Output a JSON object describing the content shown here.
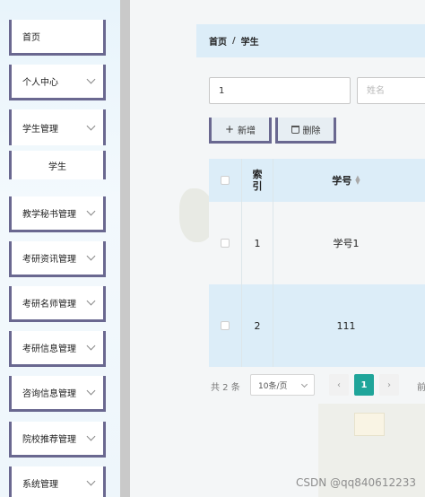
{
  "sidebar": {
    "items": [
      {
        "label": "首页",
        "has_chevron": false
      },
      {
        "label": "个人中心",
        "has_chevron": true
      },
      {
        "label": "学生管理",
        "has_chevron": true
      },
      {
        "label": "教学秘书管理",
        "has_chevron": true
      },
      {
        "label": "考研资讯管理",
        "has_chevron": true
      },
      {
        "label": "考研名师管理",
        "has_chevron": true
      },
      {
        "label": "考研信息管理",
        "has_chevron": true
      },
      {
        "label": "咨询信息管理",
        "has_chevron": true
      },
      {
        "label": "院校推荐管理",
        "has_chevron": true
      },
      {
        "label": "系统管理",
        "has_chevron": true
      }
    ],
    "submenu": {
      "label": "学生"
    }
  },
  "breadcrumb": {
    "home": "首页",
    "separator": "/",
    "current": "学生"
  },
  "search": {
    "index_value": "1",
    "name_placeholder": "姓名"
  },
  "actions": {
    "add_label": "新增",
    "delete_label": "删除"
  },
  "table": {
    "headers": {
      "index_line1": "索",
      "index_line2": "引",
      "student_no": "学号"
    },
    "rows": [
      {
        "index": "1",
        "student_no": "学号1"
      },
      {
        "index": "2",
        "student_no": "111"
      }
    ]
  },
  "pagination": {
    "total": "共 2 条",
    "page_size": "10条/页",
    "current_page": "1",
    "jump_label": "前"
  },
  "watermark": "CSDN @qq840612233",
  "colors": {
    "accent": "#1fa59a",
    "header_bg": "#dcedf8",
    "border_accent": "#6a6890"
  }
}
